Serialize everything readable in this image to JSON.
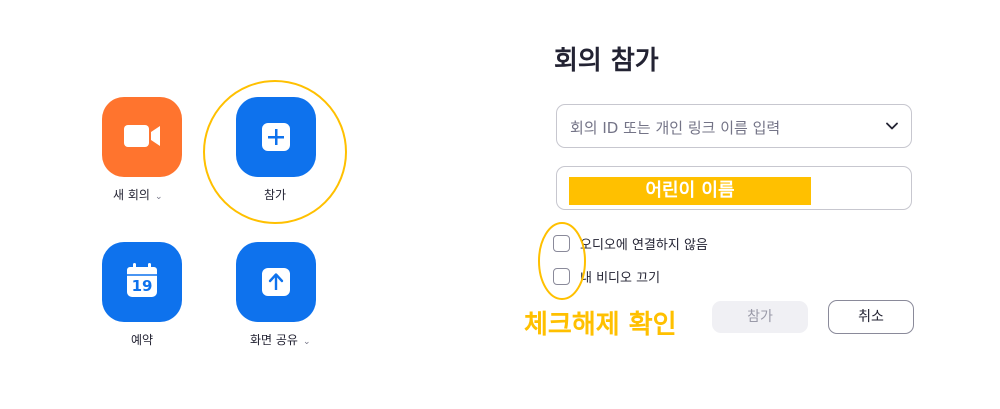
{
  "tiles": {
    "new_meeting": {
      "label": "새 회의",
      "chevron": "⌄",
      "icon": "video-camera-icon",
      "color": "#FF742E"
    },
    "join": {
      "label": "참가",
      "icon": "plus-icon",
      "color": "#0E72ED"
    },
    "schedule": {
      "label": "예약",
      "icon": "calendar-icon",
      "calendar_day": "19",
      "color": "#0E72ED"
    },
    "share_screen": {
      "label": "화면 공유",
      "chevron": "⌄",
      "icon": "upload-arrow-icon",
      "color": "#0E72ED"
    }
  },
  "dialog": {
    "title": "회의 참가",
    "meeting_id_placeholder": "회의 ID 또는 개인 링크 이름 입력",
    "name_value": "어린이 이름",
    "options": [
      {
        "label": "오디오에 연결하지 않음",
        "checked": false
      },
      {
        "label": "내 비디오 끄기",
        "checked": false
      }
    ],
    "join_button": "참가",
    "cancel_button": "취소"
  },
  "annotation": {
    "text": "체크해제 확인",
    "color": "#FFC000"
  }
}
